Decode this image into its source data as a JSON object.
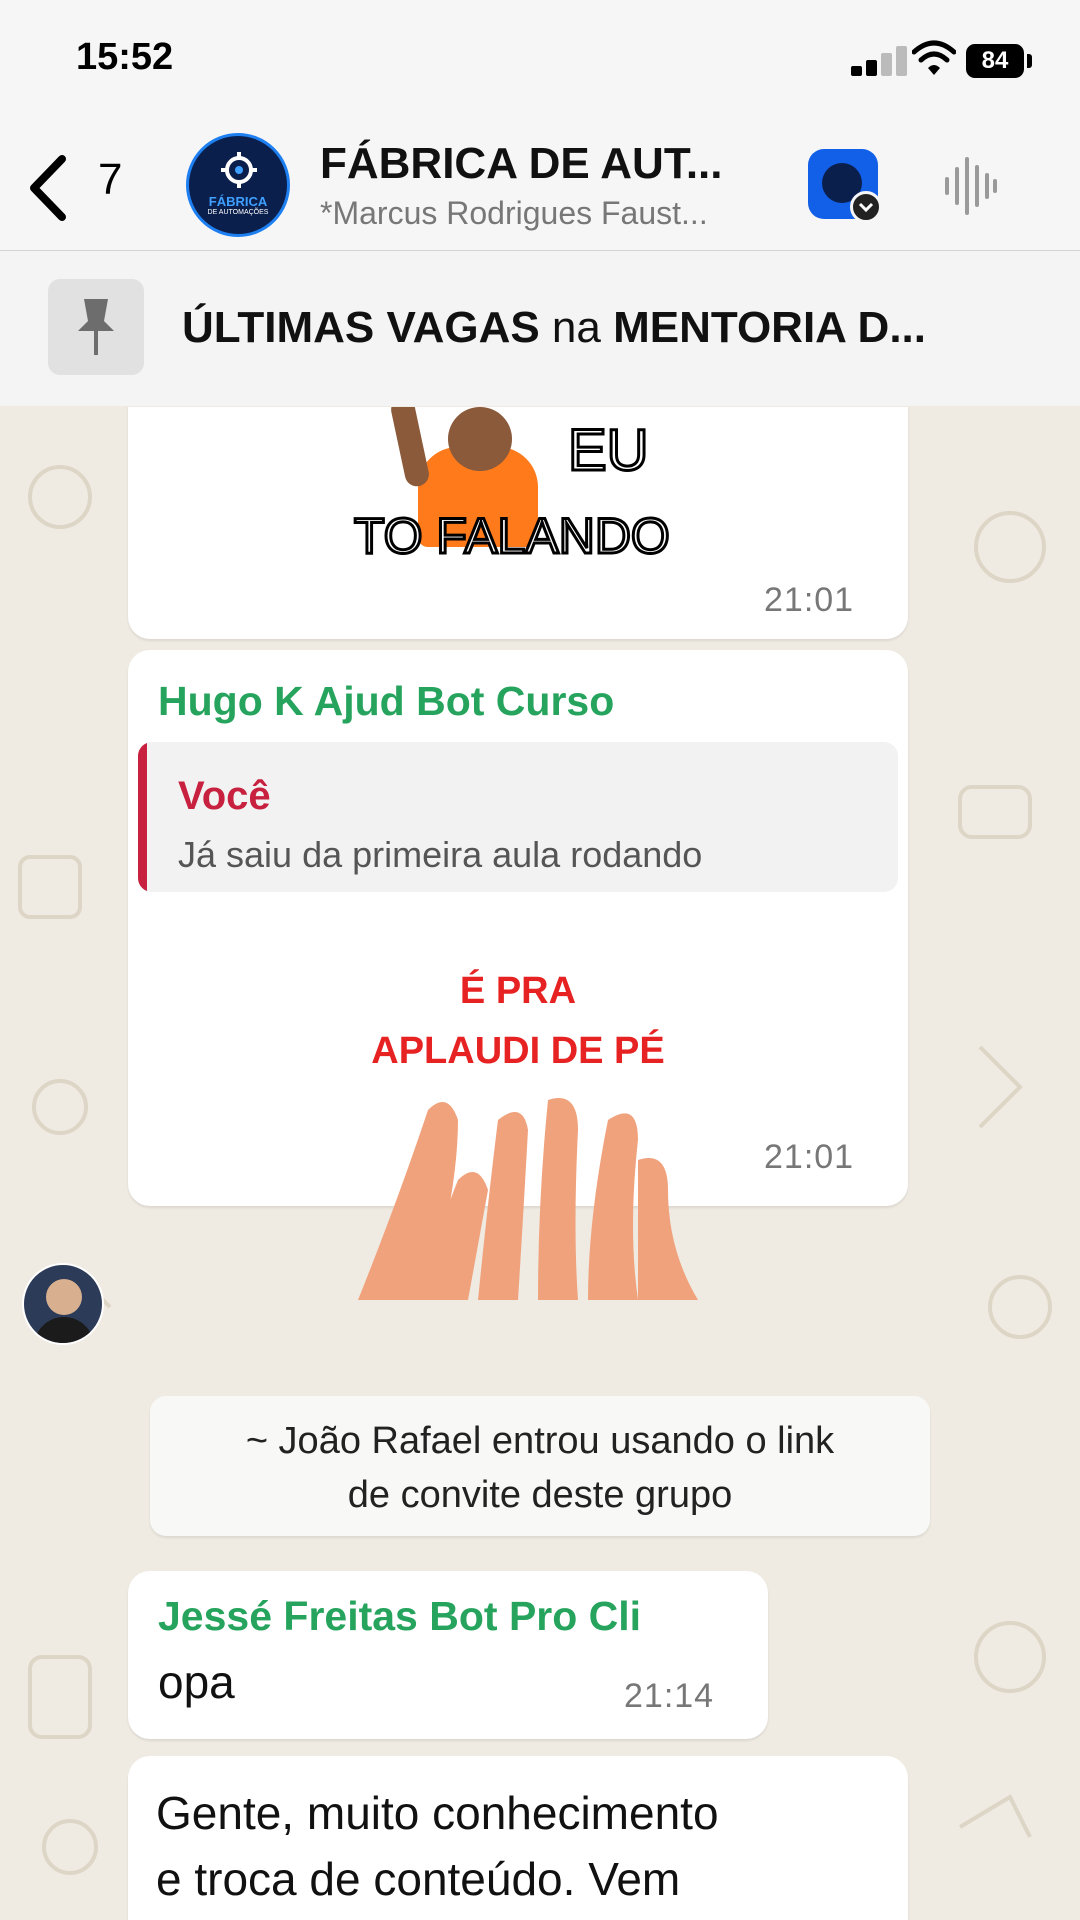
{
  "status_bar": {
    "time": "15:52",
    "battery": "84"
  },
  "header": {
    "back_count": "7",
    "title": "FÁBRICA DE AUT...",
    "subtitle": "*Marcus Rodrigues Faust...",
    "avatar_text_line1": "FÁBRICA",
    "avatar_text_line2": "DE AUTOMAÇÕES"
  },
  "pinned": {
    "text_bold1": "ÚLTIMAS VAGAS",
    "text_normal": " na ",
    "text_bold2": "MENTORIA D..."
  },
  "messages": [
    {
      "sticker_text1": "EU",
      "sticker_text2": "TO FALANDO",
      "time": "21:01"
    },
    {
      "sender": "Hugo K Ajud Bot Curso",
      "quote_author": "Você",
      "quote_text": "Já saiu da primeira aula rodando",
      "sticker_line1": "É PRA",
      "sticker_line2": "APLAUDI DE PÉ",
      "time": "21:01"
    },
    {
      "system_line1": "~ João Rafael entrou usando o link",
      "system_line2": "de convite deste grupo"
    },
    {
      "sender": "Jessé Freitas Bot Pro Cli",
      "text": "opa",
      "time": "21:14"
    },
    {
      "line1": "Gente, muito conhecimento",
      "line2": "e troca de conteúdo. Vem"
    }
  ],
  "colors": {
    "sender_green": "#26a45d",
    "quote_red": "#c7213f",
    "chat_bg": "#efeae2"
  }
}
